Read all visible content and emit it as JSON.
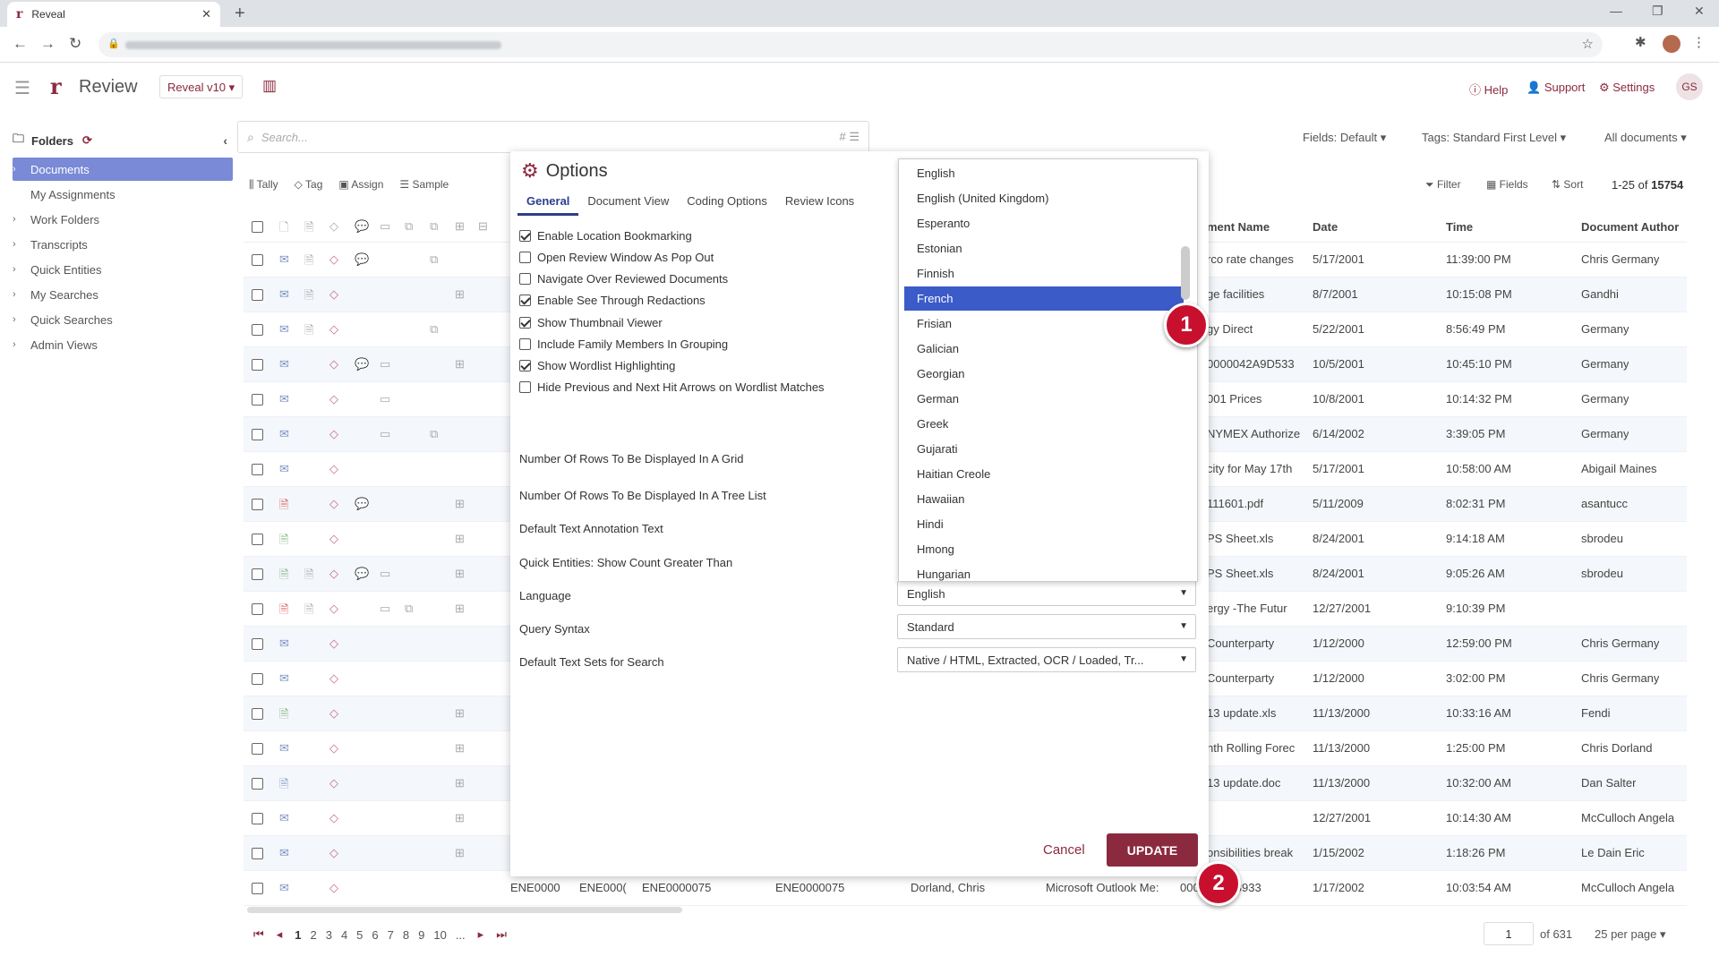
{
  "browser": {
    "tab_title": "Reveal",
    "tab_favicon": "r",
    "new_tab": "+",
    "close": "✕"
  },
  "app": {
    "title": "Review",
    "version": "Reveal v10 ▾",
    "help": "ⓘ Help",
    "support": "Support",
    "settings": "⚙ Settings",
    "avatar": "GS"
  },
  "sidebar": {
    "header": "Folders",
    "items": [
      {
        "label": "Documents",
        "active": true
      },
      {
        "label": "My Assignments"
      },
      {
        "label": "Work Folders"
      },
      {
        "label": "Transcripts"
      },
      {
        "label": "Quick Entities"
      },
      {
        "label": "My Searches"
      },
      {
        "label": "Quick Searches"
      },
      {
        "label": "Admin Views"
      }
    ]
  },
  "search": {
    "placeholder": "Search..."
  },
  "filters": {
    "fields": "Fields: Default ▾",
    "tags": "Tags: Standard First Level ▾",
    "docs": "All documents ▾"
  },
  "actions": {
    "tally": "Tally",
    "tag": "Tag",
    "assign": "Assign",
    "sample": "Sample",
    "filter": "Filter",
    "fields": "Fields",
    "sort": "Sort",
    "count_prefix": "1-25",
    "count_of": " of ",
    "count_total": "15754"
  },
  "grid": {
    "headers": {
      "docname": "ment Name",
      "date": "Date",
      "time": "Time",
      "author": "Document Author"
    },
    "rows": [
      {
        "docname": "rco rate changes",
        "date": "5/17/2001",
        "time": "11:39:00 PM",
        "author": "Chris Germany"
      },
      {
        "docname": "ge facilities",
        "date": "8/7/2001",
        "time": "10:15:08 PM",
        "author": "Gandhi"
      },
      {
        "docname": "gy Direct",
        "date": "5/22/2001",
        "time": "8:56:49 PM",
        "author": "Germany"
      },
      {
        "docname": "0000042A9D533",
        "date": "10/5/2001",
        "time": "10:45:10 PM",
        "author": "Germany"
      },
      {
        "docname": "001 Prices",
        "date": "10/8/2001",
        "time": "10:14:32 PM",
        "author": "Germany"
      },
      {
        "docname": "NYMEX Authorize",
        "date": "6/14/2002",
        "time": "3:39:05 PM",
        "author": "Germany"
      },
      {
        "docname": "city for May 17th",
        "date": "5/17/2001",
        "time": "10:58:00 AM",
        "author": "Abigail Maines"
      },
      {
        "docname": "111601.pdf",
        "date": "5/11/2009",
        "time": "8:02:31 PM",
        "author": "asantucc"
      },
      {
        "docname": "PS Sheet.xls",
        "date": "8/24/2001",
        "time": "9:14:18 AM",
        "author": "sbrodeu"
      },
      {
        "docname": "PS Sheet.xls",
        "date": "8/24/2001",
        "time": "9:05:26 AM",
        "author": "sbrodeu"
      },
      {
        "docname": "ergy -The Futur",
        "date": "12/27/2001",
        "time": "9:10:39 PM",
        "author": ""
      },
      {
        "docname": "Counterparty",
        "date": "1/12/2000",
        "time": "12:59:00 PM",
        "author": "Chris Germany"
      },
      {
        "docname": "Counterparty",
        "date": "1/12/2000",
        "time": "3:02:00 PM",
        "author": "Chris Germany"
      },
      {
        "docname": "13 update.xls",
        "date": "11/13/2000",
        "time": "10:33:16 AM",
        "author": "Fendi"
      },
      {
        "docname": "nth Rolling Forec",
        "date": "11/13/2000",
        "time": "1:25:00 PM",
        "author": "Chris Dorland"
      },
      {
        "docname": "13 update.doc",
        "date": "11/13/2000",
        "time": "10:32:00 AM",
        "author": "Dan Salter"
      },
      {
        "docname": "",
        "date": "12/27/2001",
        "time": "10:14:30 AM",
        "author": "McCulloch Angela"
      },
      {
        "docname": "onsibilities break",
        "date": "1/15/2002",
        "time": "1:18:26 PM",
        "author": "Le Dain Eric"
      },
      {
        "docname": "EB048933",
        "date": "1/17/2002",
        "time": "10:03:54 AM",
        "author": "McCulloch Angela"
      }
    ],
    "last_row_left": {
      "c1": "ENE0000",
      "c2": "ENE000(",
      "c3": "ENE0000075",
      "c4": "ENE0000075",
      "c5": "Dorland, Chris",
      "c6": "Microsoft Outlook Me:",
      "c7": "000"
    }
  },
  "pager": {
    "pages": [
      "1",
      "2",
      "3",
      "4",
      "5",
      "6",
      "7",
      "8",
      "9",
      "10",
      "..."
    ],
    "current_page": "1",
    "of_pages": "of 631",
    "per_page": "25 per page"
  },
  "modal": {
    "title": "Options",
    "tabs": [
      "General",
      "Document View",
      "Coding Options",
      "Review Icons"
    ],
    "checkboxes": [
      {
        "label": "Enable Location Bookmarking",
        "checked": true
      },
      {
        "label": "Open Review Window As Pop Out",
        "checked": false
      },
      {
        "label": "Navigate Over Reviewed Documents",
        "checked": false
      },
      {
        "label": "Enable See Through Redactions",
        "checked": true
      },
      {
        "label": "Show Thumbnail Viewer",
        "checked": true
      },
      {
        "label": "Include Family Members In Grouping",
        "checked": false
      },
      {
        "label": "Show Wordlist Highlighting",
        "checked": true
      },
      {
        "label": "Hide Previous and Next Hit Arrows on Wordlist Matches",
        "checked": false
      }
    ],
    "fields": {
      "rows_grid": "Number Of Rows To Be Displayed In A Grid",
      "rows_tree": "Number Of Rows To Be Displayed In A Tree List",
      "annotation": "Default Text Annotation Text",
      "quick_entities": "Quick Entities: Show Count Greater Than",
      "language": "Language",
      "query_syntax": "Query Syntax",
      "text_sets": "Default Text Sets for Search"
    },
    "values": {
      "language": "English",
      "query_syntax": "Standard",
      "text_sets": "Native / HTML, Extracted, OCR / Loaded, Tr..."
    },
    "cancel": "Cancel",
    "update": "UPDATE"
  },
  "language_dropdown": {
    "selected": "French",
    "options": [
      "English",
      "English (United Kingdom)",
      "Esperanto",
      "Estonian",
      "Finnish",
      "French",
      "Frisian",
      "Galician",
      "Georgian",
      "German",
      "Greek",
      "Gujarati",
      "Haitian Creole",
      "Hawaiian",
      "Hindi",
      "Hmong",
      "Hungarian"
    ]
  },
  "badges": {
    "one": "1",
    "two": "2"
  },
  "colors": {
    "brand": "#8b2a3f",
    "selection": "#3b5bc9",
    "badge": "#c8102e",
    "sidebar_active": "#7a8ad6"
  }
}
